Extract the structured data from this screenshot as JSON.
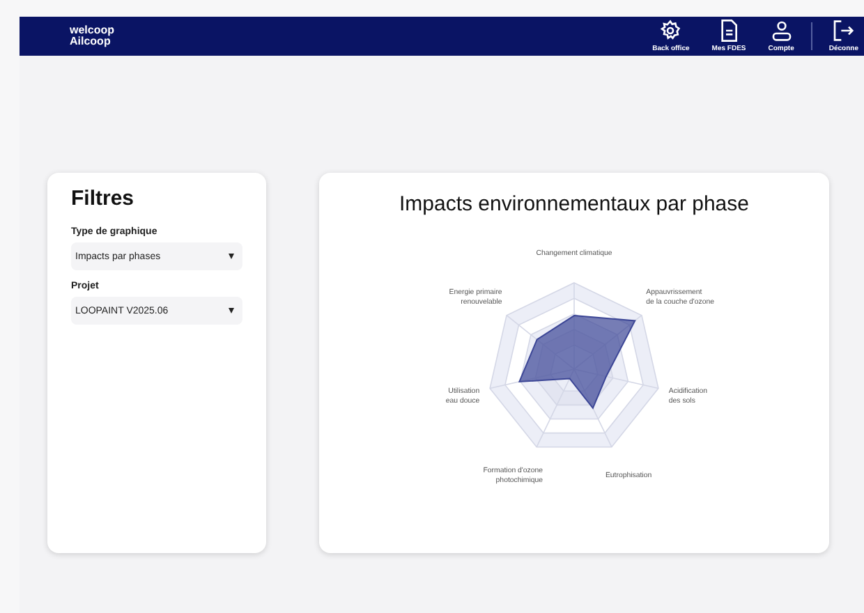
{
  "header": {
    "logo_top": "welcoop",
    "logo_bottom": "Ailcoop",
    "nav": [
      {
        "label": "Back office",
        "kind": "gear"
      },
      {
        "label": "Mes FDES",
        "kind": "document"
      },
      {
        "label": "Compte",
        "kind": "user"
      },
      {
        "label": "Déconne",
        "kind": "logout"
      }
    ]
  },
  "filters": {
    "title": "Filtres",
    "fields": [
      {
        "label": "Type de graphique",
        "value": "Impacts par phases"
      },
      {
        "label": "Projet",
        "value": "LOOPAINT V2025.06"
      }
    ]
  },
  "chart": {
    "title": "Impacts environnementaux par phase",
    "axes": [
      [
        "Changement climatique"
      ],
      [
        "Energie primaire",
        "renouvelable"
      ],
      [
        "Appauvrissement",
        "de la couche d'ozone"
      ],
      [
        "Utilisation",
        "eau douce"
      ],
      [
        "Acidification",
        "des sols"
      ],
      [
        "Formation d'ozone",
        "photochimique"
      ],
      [
        "Eutrophisation"
      ]
    ]
  }
}
